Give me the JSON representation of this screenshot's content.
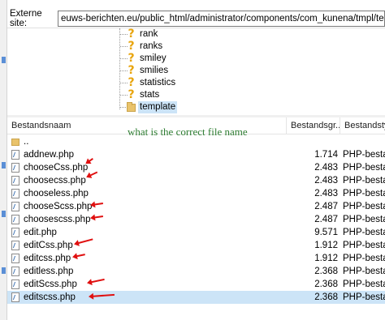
{
  "site_bar": {
    "label": "Externe site:",
    "path": "euws-berichten.eu/public_html/administrator/components/com_kunena/tmpl/template"
  },
  "tree": {
    "items": [
      {
        "label": "rank",
        "icon": "question-icon"
      },
      {
        "label": "ranks",
        "icon": "question-icon"
      },
      {
        "label": "smiley",
        "icon": "question-icon"
      },
      {
        "label": "smilies",
        "icon": "question-icon"
      },
      {
        "label": "statistics",
        "icon": "question-icon"
      },
      {
        "label": "stats",
        "icon": "question-icon"
      },
      {
        "label": "template",
        "icon": "folder-icon",
        "selected": true
      }
    ]
  },
  "file_list": {
    "columns": {
      "name": "Bestandsnaam",
      "size": "Bestandsgr...",
      "type": "Bestandstyp"
    },
    "annotation": "what is the correct file name",
    "rows": [
      {
        "name": "..",
        "size": "",
        "type": "",
        "icon": "folder-up-icon"
      },
      {
        "name": "addnew.php",
        "size": "1.714",
        "type": "PHP-bestan",
        "icon": "php-file-icon"
      },
      {
        "name": "chooseCss.php",
        "size": "2.483",
        "type": "PHP-bestan",
        "icon": "php-file-icon"
      },
      {
        "name": "choosecss.php",
        "size": "2.483",
        "type": "PHP-bestan",
        "icon": "php-file-icon"
      },
      {
        "name": "chooseless.php",
        "size": "2.483",
        "type": "PHP-bestan",
        "icon": "php-file-icon"
      },
      {
        "name": "chooseScss.php",
        "size": "2.487",
        "type": "PHP-bestan",
        "icon": "php-file-icon"
      },
      {
        "name": "choosescss.php",
        "size": "2.487",
        "type": "PHP-bestan",
        "icon": "php-file-icon"
      },
      {
        "name": "edit.php",
        "size": "9.571",
        "type": "PHP-bestan",
        "icon": "php-file-icon"
      },
      {
        "name": "editCss.php",
        "size": "1.912",
        "type": "PHP-bestan",
        "icon": "php-file-icon"
      },
      {
        "name": "editcss.php",
        "size": "1.912",
        "type": "PHP-bestan",
        "icon": "php-file-icon"
      },
      {
        "name": "editless.php",
        "size": "2.368",
        "type": "PHP-bestan",
        "icon": "php-file-icon"
      },
      {
        "name": "editScss.php",
        "size": "2.368",
        "type": "PHP-bestan",
        "icon": "php-file-icon"
      },
      {
        "name": "editscss.php",
        "size": "2.368",
        "type": "PHP-bestan",
        "icon": "php-file-icon",
        "selected": true
      }
    ]
  },
  "colors": {
    "annotation_text": "#2e7d32",
    "arrow": "#e01010",
    "selection": "#cce4f7",
    "question_icon": "#e8a40c"
  }
}
